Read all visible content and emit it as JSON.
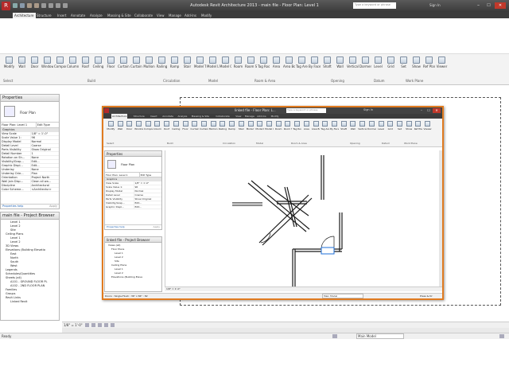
{
  "window": {
    "title": "Autodesk Revit Architecture 2013 -  main file - Floor Plan: Level 1",
    "search_placeholder": "Type a keyword or phrase",
    "sign_in": "Sign In"
  },
  "menu_tabs": [
    "Architecture",
    "Structure",
    "Insert",
    "Annotate",
    "Analyze",
    "Massing & Site",
    "Collaborate",
    "View",
    "Manage",
    "Add-Ins",
    "Modify"
  ],
  "ribbon": {
    "buttons": [
      "Modify",
      "Wall",
      "Door",
      "Window",
      "Component",
      "Column",
      "Roof",
      "Ceiling",
      "Floor",
      "Curtain System",
      "Curtain Grid",
      "Mullion",
      "Railing",
      "Ramp",
      "Stair",
      "Model Text",
      "Model Line",
      "Model Group",
      "Room",
      "Room Separator",
      "Tag Room",
      "Area",
      "Area Boundary",
      "Tag Area",
      "By Face",
      "Shaft",
      "Wall",
      "Vertical",
      "Dormer",
      "Level",
      "Grid",
      "Set",
      "Show",
      "Ref Plane",
      "Viewer"
    ],
    "groups": [
      "Select",
      "Build",
      "Circulation",
      "Model",
      "Room & Area",
      "Opening",
      "Datum",
      "Work Plane"
    ]
  },
  "properties": {
    "title": "Properties",
    "type_name": "Floor Plan",
    "selector": "Floor Plan: Level 1",
    "edit_type": "Edit Type",
    "section": "Graphics",
    "rows": [
      [
        "View Scale",
        "1/8\" = 1'-0\""
      ],
      [
        "Scale Value 1:",
        "96"
      ],
      [
        "Display Model",
        "Normal"
      ],
      [
        "Detail Level",
        "Coarse"
      ],
      [
        "Parts Visibility",
        "Show Original"
      ],
      [
        "Detail Number",
        "1"
      ],
      [
        "Rotation on Sh...",
        "None"
      ],
      [
        "Visibility/Grap...",
        "Edit..."
      ],
      [
        "Graphic Displ...",
        "Edit..."
      ],
      [
        "Underlay",
        "None"
      ],
      [
        "Underlay Orie...",
        "Plan"
      ],
      [
        "Orientation",
        "Project North"
      ],
      [
        "Wall Join Disp...",
        "Clean all wa..."
      ],
      [
        "Discipline",
        "Architectural"
      ],
      [
        "Color Scheme...",
        "<Architectur>"
      ]
    ],
    "help": "Properties help",
    "apply": "Apply"
  },
  "project_browser": {
    "title": "main file - Project Browser",
    "items": [
      "Level 1",
      "Level 2",
      "Site",
      "Ceiling Plans",
      "Level 1",
      "Level 2",
      "3D Views",
      "Elevations (Building Elevatio",
      "East",
      "North",
      "South",
      "West",
      "Legends",
      "Schedules/Quantities",
      "Sheets (all)",
      "A101 - GROUND FLOOR PL",
      "A102 - 2ND FLOOR PLAN",
      "Families",
      "Groups",
      "Revit Links",
      "Linked Revit"
    ]
  },
  "main_view": {
    "scale": "1/8\" = 1'-0\""
  },
  "inner_window": {
    "title": "linked file - Floor Plan: L...",
    "search_placeholder": "Type a keyword or phrase",
    "sign_in": "Sign In",
    "tabs": [
      "Architecture",
      "Structure",
      "Insert",
      "Annotate",
      "Analyze",
      "Massing & Site",
      "Collaborate",
      "View",
      "Manage",
      "Add-Ins",
      "Modify"
    ],
    "buttons": [
      "Modify",
      "Wall",
      "Door",
      "Window",
      "Component",
      "Column",
      "Roof",
      "Ceiling",
      "Floor",
      "Curtain System",
      "Curtain Grid",
      "Mullion",
      "Railing",
      "Ramp",
      "Stair",
      "Model Text",
      "Model Line",
      "Model Group",
      "Room",
      "Room Separator",
      "Tag Room",
      "Area",
      "Area Boundary",
      "Tag Area",
      "By Face",
      "Shaft",
      "Wall",
      "Vertical",
      "Dormer",
      "Level",
      "Grid",
      "Set",
      "Show",
      "Ref Plane",
      "Viewer"
    ],
    "groups": [
      "Select",
      "Build",
      "Circulation",
      "Model",
      "Room & Area",
      "Opening",
      "Datum",
      "Work Plane"
    ],
    "properties": {
      "title": "Properties",
      "type_name": "Floor Plan",
      "selector": "Floor Plan: Level 1",
      "edit_type": "Edit Type",
      "section": "Graphics",
      "rows": [
        [
          "View Scale",
          "1/8\" = 1'-0\""
        ],
        [
          "Scale Value 1:",
          "96"
        ],
        [
          "Display Model",
          "Normal"
        ],
        [
          "Detail Level",
          "Coarse"
        ],
        [
          "Parts Visibility",
          "Show Original"
        ],
        [
          "Visibility/Grap...",
          "Edit..."
        ],
        [
          "Graphic Displ...",
          "Edit..."
        ]
      ],
      "help": "Properties help",
      "apply": "Apply"
    },
    "browser": {
      "title": "linked file - Project Browser",
      "items": [
        "Views (all)",
        "Floor Plans",
        "Level 1",
        "Level 2",
        "Site",
        "Ceiling Plans",
        "Level 1",
        "Level 2",
        "Elevations (Building Eleva"
      ]
    },
    "scale": "1/8\" = 1'-0\"",
    "status_left": "Doors : Single-Flush : 36\" x 84\" : 82",
    "status_model": "Main Model",
    "status_right": "Press & Dr"
  },
  "status_bar": {
    "left": "Ready",
    "model": "Main Model"
  }
}
